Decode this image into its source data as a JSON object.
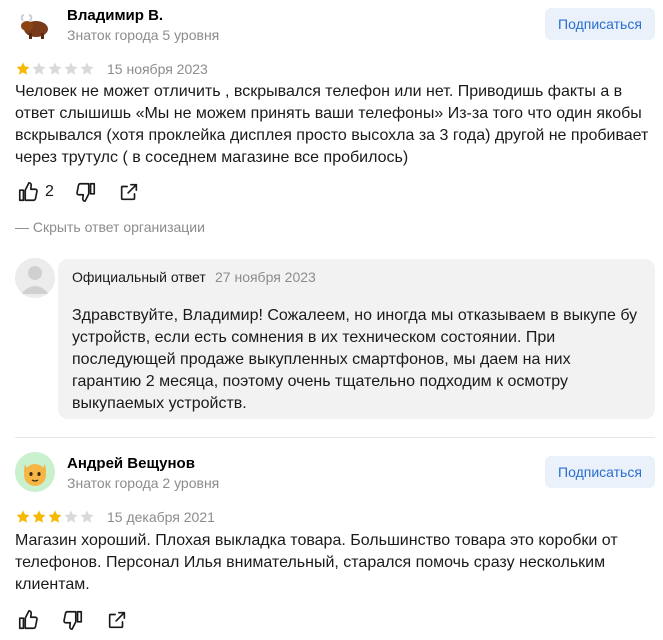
{
  "reviews": [
    {
      "author": "Владимир В.",
      "level": "Знаток города 5 уровня",
      "subscribe": "Подписаться",
      "rating": 1,
      "date": "15 ноября 2023",
      "text": "Человек не может отличить , вскрывался телефон или нет. Приводишь факты а в ответ слышишь «Мы не можем принять ваши телефоны» Из-за того что один якобы вскрывался (хотя проклейка дисплея просто высохла за 3 года) другой не пробивает через трутулс ( в соседнем магазине все пробилось)",
      "likes": "2",
      "hide_reply": "— Скрыть ответ организации",
      "reply": {
        "title": "Официальный ответ",
        "date": "27 ноября 2023",
        "text": "Здравствуйте, Владимир! Сожалеем, но иногда мы отказываем в выкупе бу устройств, если есть сомнения в их техническом состоянии. При последующей продаже выкупленных смартфонов, мы даем на них гарантию 2 месяца, поэтому очень тщательно подходим к осмотру выкупаемых устройств."
      }
    },
    {
      "author": "Андрей Вещунов",
      "level": "Знаток города 2 уровня",
      "subscribe": "Подписаться",
      "rating": 3,
      "date": "15 декабря 2021",
      "text": "Магазин хороший. Плохая выкладка товара. Большинство товара это коробки от телефонов. Персонал Илья внимательный, старался помочь сразу нескольким клиентам."
    }
  ],
  "colors": {
    "star_filled": "#f6b800",
    "star_empty": "#d9d9d9",
    "accent": "#2a6ecf"
  },
  "icons": [
    "yak-avatar",
    "cat-avatar",
    "thumb-up-icon",
    "thumb-down-icon",
    "share-icon",
    "user-placeholder-icon"
  ]
}
